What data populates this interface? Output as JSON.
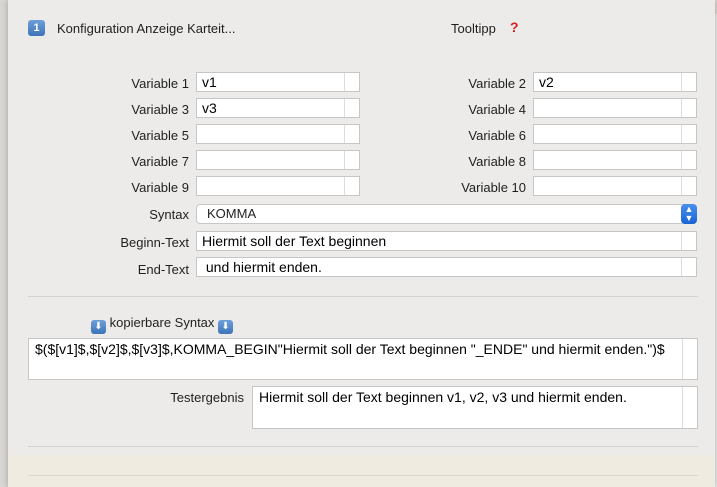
{
  "header": {
    "icon_glyph": "1",
    "title": "Konfiguration Anzeige Karteit...",
    "tooltip_label": "Tooltipp",
    "help_glyph": "?"
  },
  "variables": [
    {
      "label": "Variable 1",
      "value": "v1"
    },
    {
      "label": "Variable 2",
      "value": "v2"
    },
    {
      "label": "Variable 3",
      "value": "v3"
    },
    {
      "label": "Variable 4",
      "value": ""
    },
    {
      "label": "Variable 5",
      "value": ""
    },
    {
      "label": "Variable 6",
      "value": ""
    },
    {
      "label": "Variable 7",
      "value": ""
    },
    {
      "label": "Variable 8",
      "value": ""
    },
    {
      "label": "Variable 9",
      "value": ""
    },
    {
      "label": "Variable 10",
      "value": ""
    }
  ],
  "syntax": {
    "label": "Syntax",
    "value": "KOMMA",
    "arrow_up": "▲",
    "arrow_down": "▼"
  },
  "begin_text": {
    "label": "Beginn-Text",
    "value": "Hiermit soll der Text beginnen"
  },
  "end_text": {
    "label": "End-Text",
    "value": " und hiermit enden."
  },
  "copyable": {
    "label": "kopierbare Syntax",
    "icon_glyph": "⬇",
    "value": "$($[v1]$,$[v2]$,$[v3]$,KOMMA_BEGIN\"Hiermit soll der Text beginnen \"_ENDE\" und hiermit enden.\")$"
  },
  "result": {
    "label": "Testergebnis",
    "value": "Hiermit soll der Text beginnen v1, v2, v3 und hiermit enden."
  }
}
